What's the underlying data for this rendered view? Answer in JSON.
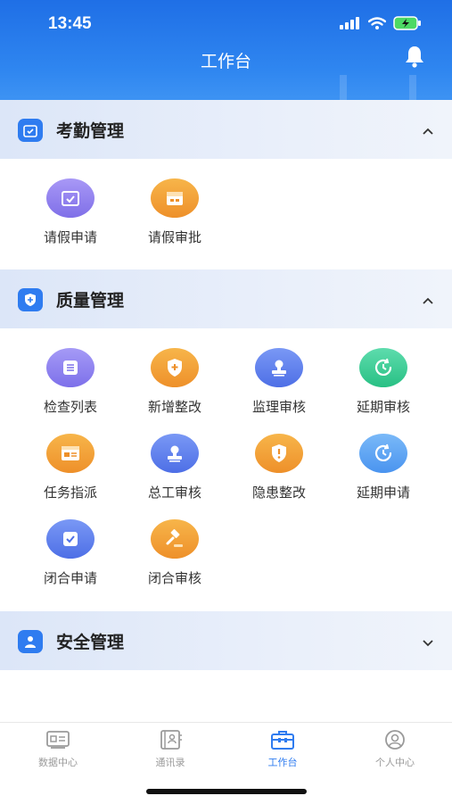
{
  "status_bar": {
    "time": "13:45"
  },
  "header": {
    "title": "工作台"
  },
  "sections": [
    {
      "title": "考勤管理",
      "expanded": true,
      "items": [
        {
          "label": "请假申请",
          "icon": "calendar-check-icon",
          "color": "#8f7ff0"
        },
        {
          "label": "请假审批",
          "icon": "calendar-icon",
          "color": "#f4a23a"
        }
      ]
    },
    {
      "title": "质量管理",
      "expanded": true,
      "items": [
        {
          "label": "检查列表",
          "icon": "list-icon",
          "color": "#8f84f2"
        },
        {
          "label": "新增整改",
          "icon": "shield-plus-icon",
          "color": "#f4a23a"
        },
        {
          "label": "监理审核",
          "icon": "stamp-icon",
          "color": "#5b7ff0"
        },
        {
          "label": "延期审核",
          "icon": "clock-refresh-icon",
          "color": "#3fcf98"
        },
        {
          "label": "任务指派",
          "icon": "task-card-icon",
          "color": "#f4a23a"
        },
        {
          "label": "总工审核",
          "icon": "stamp-icon",
          "color": "#5b7ff0"
        },
        {
          "label": "隐患整改",
          "icon": "shield-alert-icon",
          "color": "#f4a23a"
        },
        {
          "label": "延期申请",
          "icon": "clock-refresh-icon",
          "color": "#5aa3f5"
        },
        {
          "label": "闭合申请",
          "icon": "check-square-icon",
          "color": "#5b7ff0"
        },
        {
          "label": "闭合审核",
          "icon": "gavel-icon",
          "color": "#f4a23a"
        }
      ]
    },
    {
      "title": "安全管理",
      "expanded": false,
      "items": []
    }
  ],
  "tabbar": [
    {
      "label": "数据中心",
      "icon": "dashboard-icon",
      "active": false
    },
    {
      "label": "通讯录",
      "icon": "contacts-icon",
      "active": false
    },
    {
      "label": "工作台",
      "icon": "briefcase-icon",
      "active": true
    },
    {
      "label": "个人中心",
      "icon": "user-icon",
      "active": false
    }
  ],
  "colors": {
    "primary": "#2f7cf0",
    "section_bg": "#e6edf9",
    "inactive_tab": "#9a9a9a"
  }
}
